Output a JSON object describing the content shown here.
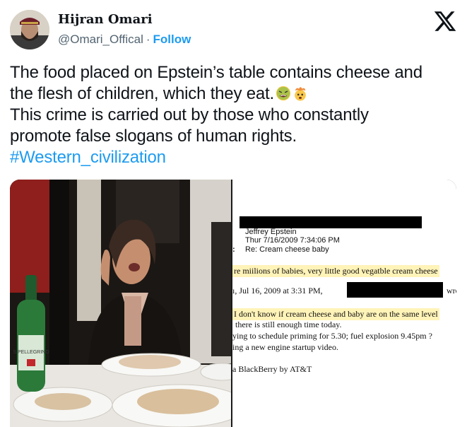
{
  "header": {
    "display_name": "Hijran Omari",
    "handle": "@Omari_Offical",
    "separator": "·",
    "follow_label": "Follow",
    "platform_icon": "x-logo-icon"
  },
  "tweet": {
    "lines": [
      "The food placed on Epstein’s table contains cheese and",
      "the flesh of children, which they eat.",
      "This crime is carried out by those who constantly",
      "promote false slogans of human rights."
    ],
    "emojis": [
      "nauseated-face-emoji",
      "exploding-head-emoji"
    ],
    "hashtag": "#Western_civilization"
  },
  "media": {
    "photo": {
      "bottle_label": "S.PELLEGRINO"
    },
    "document": {
      "from": "Jeffrey Epstein",
      "sent": "Thur 7/16/2009 7:34:06 PM",
      "subject_prefix": ":",
      "subject": "Re: Cream cheese baby",
      "line1": "re miilions of babies, very little good vegatble cream cheese",
      "line2_date": "ı, Jul 16, 2009 at 3:31 PM,",
      "line2_wrote": "wrot",
      "line3": "I don't know if cream cheese and baby are on the same level",
      "line4": "there is still enough time today.",
      "line5": "ying to schedule priming for 5.30; fuel explosion 9.45pm ?",
      "line6": "ing a new engine startup video.",
      "line7": "a BlackBerry by AT&T"
    }
  },
  "colors": {
    "text": "#0f1419",
    "secondary": "#536471",
    "accent": "#1d9bf0"
  }
}
